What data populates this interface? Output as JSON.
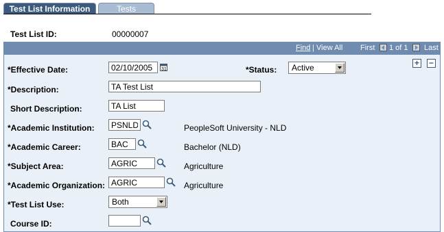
{
  "tabs": [
    {
      "label": "Test List Information",
      "active": true
    },
    {
      "label": "Tests",
      "active": false
    }
  ],
  "header": {
    "id_label": "Test List ID:",
    "id_value": "00000007"
  },
  "nav": {
    "find": "Find",
    "view_all": "View All",
    "first": "First",
    "range": "1 of 1",
    "last": "Last"
  },
  "form": {
    "effective_date": {
      "label": "*Effective Date:",
      "value": "02/10/2005"
    },
    "status": {
      "label": "*Status:",
      "value": "Active"
    },
    "description": {
      "label": "*Description:",
      "value": "TA Test List"
    },
    "short_description": {
      "label": "Short Description:",
      "value": "TA List"
    },
    "academic_institution": {
      "label": "*Academic Institution:",
      "value": "PSNLD",
      "desc": "PeopleSoft University -  NLD"
    },
    "academic_career": {
      "label": "*Academic Career:",
      "value": "BAC",
      "desc": "Bachelor (NLD)"
    },
    "subject_area": {
      "label": "*Subject Area:",
      "value": "AGRIC",
      "desc": "Agriculture"
    },
    "academic_organization": {
      "label": "*Academic Organization:",
      "value": "AGRIC",
      "desc": "Agriculture"
    },
    "test_list_use": {
      "label": "*Test List Use:",
      "value": "Both"
    },
    "course_id": {
      "label": "Course ID:",
      "value": ""
    }
  },
  "colors": {
    "tab_active": "#3b5a7d",
    "tab_inactive": "#a8bcd2",
    "panel_header": "#6f8bb0",
    "panel_bg": "#eaf0f7"
  }
}
